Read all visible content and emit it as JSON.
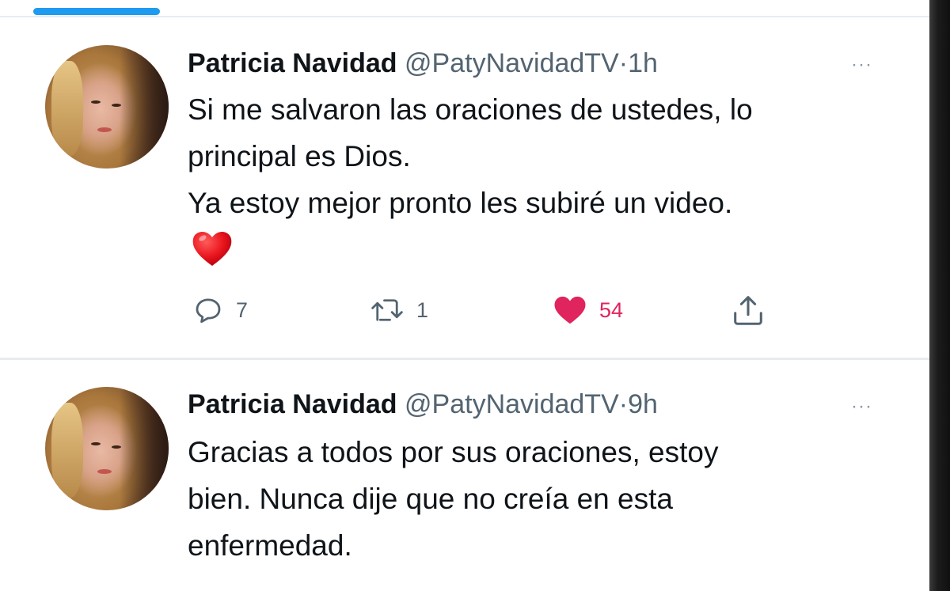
{
  "tweets": [
    {
      "name": "Patricia Navidad",
      "handle": "@PatyNavidadTV",
      "separator": "·",
      "time": "1h",
      "more": "···",
      "lines": [
        "Si me salvaron las oraciones de ustedes, lo",
        "principal es Dios.",
        "Ya estoy mejor pronto les subiré un video."
      ],
      "emoji": "red-heart",
      "replies": "7",
      "retweets": "1",
      "likes": "54",
      "liked": true
    },
    {
      "name": "Patricia Navidad",
      "handle": "@PatyNavidadTV",
      "separator": "·",
      "time": "9h",
      "more": "···",
      "lines": [
        "Gracias a todos por sus oraciones, estoy",
        "bien. Nunca dije que no creía en esta",
        "enfermedad."
      ]
    }
  ],
  "colors": {
    "accent": "#1d9bf0",
    "like": "#e0245e",
    "secondary_text": "#536471",
    "divider": "#e6ecf0"
  },
  "icons": [
    "reply-icon",
    "retweet-icon",
    "like-icon",
    "share-icon",
    "more-icon"
  ]
}
